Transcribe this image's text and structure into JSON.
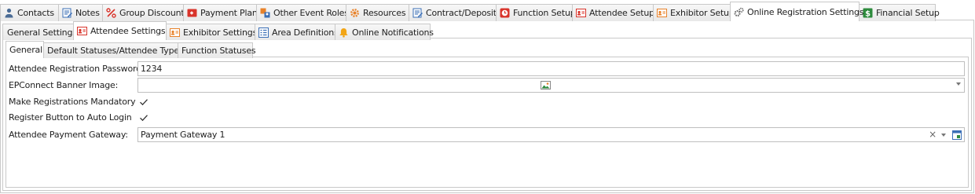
{
  "top_tabs": [
    {
      "label": "Contacts",
      "icon": "person-icon",
      "active": false
    },
    {
      "label": "Notes",
      "icon": "note-edit-icon",
      "active": false
    },
    {
      "label": "Group Discounts",
      "icon": "percent-icon",
      "active": false
    },
    {
      "label": "Payment Plan",
      "icon": "payment-card-icon",
      "active": false
    },
    {
      "label": "Other Event Roles",
      "icon": "roles-icon",
      "active": false
    },
    {
      "label": "Resources",
      "icon": "gear-orange-icon",
      "active": false
    },
    {
      "label": "Contract/Deposit",
      "icon": "contract-edit-icon",
      "active": false
    },
    {
      "label": "Function Setup",
      "icon": "clock-red-icon",
      "active": false
    },
    {
      "label": "Attendee Setup",
      "icon": "id-card-red-icon",
      "active": false
    },
    {
      "label": "Exhibitor Setup",
      "icon": "id-card-orange-icon",
      "active": false
    },
    {
      "label": "Online Registration Settings",
      "icon": "gears-icon",
      "active": true
    },
    {
      "label": "Financial Setup",
      "icon": "dollar-icon",
      "active": false
    }
  ],
  "second_tabs": [
    {
      "label": "General Settings",
      "icon": "",
      "active": false
    },
    {
      "label": "Attendee Settings",
      "icon": "id-card-red-icon",
      "active": true
    },
    {
      "label": "Exhibitor Settings",
      "icon": "id-card-orange-icon",
      "active": false
    },
    {
      "label": "Area Definitions",
      "icon": "list-icon",
      "active": false
    },
    {
      "label": "Online Notifications",
      "icon": "bell-icon",
      "active": false
    }
  ],
  "third_tabs": [
    {
      "label": "General",
      "active": true
    },
    {
      "label": "Default Statuses/Attendee Types",
      "active": false
    },
    {
      "label": "Function Statuses",
      "active": false
    }
  ],
  "form": {
    "password_label": "Attendee Registration Password:",
    "password_value": "1234",
    "banner_label": "EPConnect Banner Image:",
    "mandatory_label": "Make Registrations Mandatory",
    "mandatory_checked": true,
    "autologin_label": "Register Button to Auto Login",
    "autologin_checked": true,
    "gateway_label": "Attendee Payment Gateway:",
    "gateway_value": "Payment Gateway 1"
  },
  "colors": {
    "red": "#d9342b",
    "orange": "#e8822a",
    "blue": "#3b6fb6",
    "green": "#2e8b3d",
    "border": "#c9c9c9"
  }
}
